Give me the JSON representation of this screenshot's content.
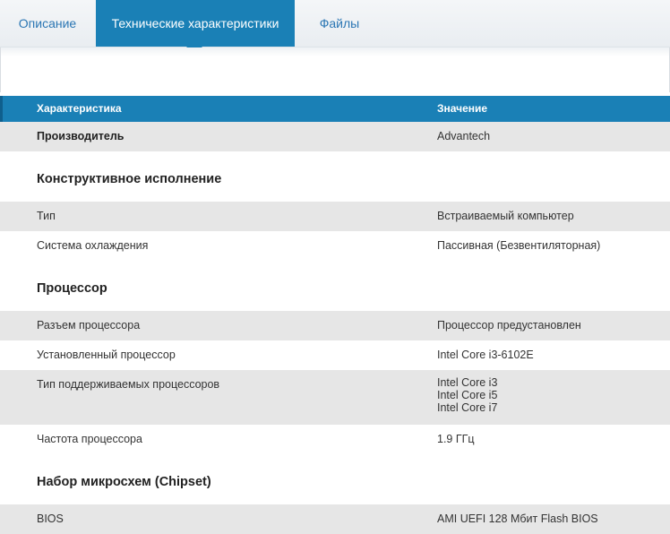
{
  "tabs": [
    {
      "label": "Описание"
    },
    {
      "label": "Технические характеристики"
    },
    {
      "label": "Файлы"
    }
  ],
  "table": {
    "header": {
      "col1": "Характеристика",
      "col2": "Значение"
    },
    "manufacturer": {
      "label": "Производитель",
      "value": "Advantech"
    },
    "sections": [
      {
        "title": "Конструктивное исполнение",
        "rows": [
          {
            "label": "Тип",
            "value": "Встраиваемый компьютер"
          },
          {
            "label": "Система охлаждения",
            "value": "Пассивная (Безвентиляторная)"
          }
        ]
      },
      {
        "title": "Процессор",
        "rows": [
          {
            "label": "Разъем процессора",
            "value": "Процессор предустановлен"
          },
          {
            "label": "Установленный процессор",
            "value": "Intel Core i3-6102E"
          },
          {
            "label": "Тип поддерживаемых процессоров",
            "values": [
              "Intel Core i3",
              "Intel Core i5",
              "Intel Core i7"
            ]
          },
          {
            "label": "Частота процессора",
            "value": "1.9 ГГц"
          }
        ]
      },
      {
        "title": "Набор микросхем (Chipset)",
        "rows": [
          {
            "label": "BIOS",
            "value": "AMI UEFI 128 Мбит Flash BIOS"
          }
        ]
      }
    ]
  }
}
